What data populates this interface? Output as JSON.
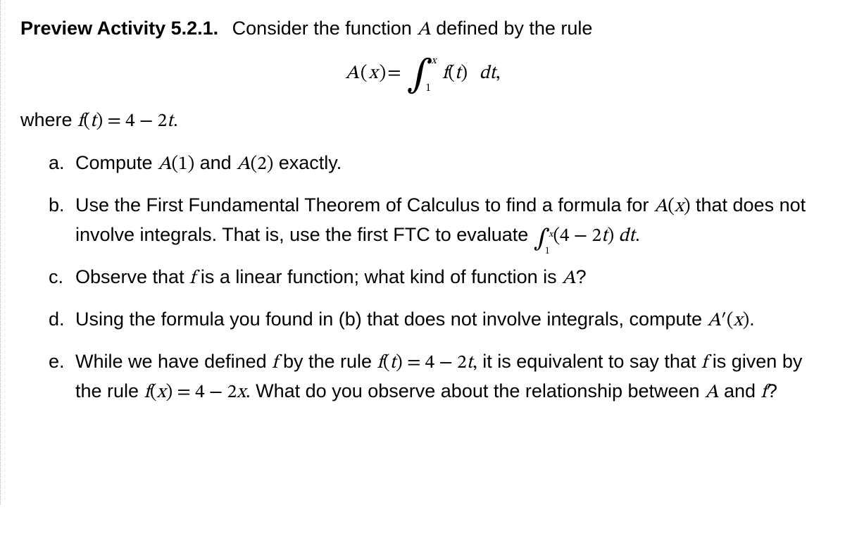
{
  "heading": {
    "label": "Preview Activity 5.2.1.",
    "intro_before": "Consider the function ",
    "intro_A": "A",
    "intro_after": " defined by the rule"
  },
  "display_equation": {
    "lhs_fn": "A",
    "lhs_arg": "x",
    "eq": " = ",
    "int_lower": "1",
    "int_upper": "x",
    "integrand_fn": "f",
    "integrand_arg": "t",
    "dt_d": "d",
    "dt_var": "t",
    "comma": ","
  },
  "where": {
    "prefix": "where ",
    "fn": "f",
    "arg": "t",
    "eq_rhs": " = 4 − 2",
    "rhs_var": "t",
    "period": "."
  },
  "items": {
    "a": {
      "marker": "a.",
      "t1": "Compute ",
      "m1_fn": "A",
      "m1_arg": "(1)",
      "t2": " and ",
      "m2_fn": "A",
      "m2_arg": "(2)",
      "t3": " exactly."
    },
    "b": {
      "marker": "b.",
      "t1": "Use the First Fundamental Theorem of Calculus to find a formula for ",
      "m1_fn": "A",
      "m1_arg": "x",
      "t2": " that does not involve integrals. That is, use the first FTC to evaluate ",
      "int_lower": "1",
      "int_upper": "x",
      "integrand_pre": "(4 − 2",
      "integrand_var": "t",
      "integrand_post": ") ",
      "dt_d": "d",
      "dt_var": "t",
      "t3": "."
    },
    "c": {
      "marker": "c.",
      "t1": "Observe that ",
      "m1": "f",
      "t2": " is a linear function; what kind of function is ",
      "m2": "A",
      "t3": "?"
    },
    "d": {
      "marker": "d.",
      "t1": "Using the formula you found in (b) that does not involve integrals, compute ",
      "m1_fn": "A",
      "m1_prime": "′",
      "m1_arg": "x",
      "t2": "."
    },
    "e": {
      "marker": "e.",
      "t1": "While we have defined ",
      "m1": "f",
      "t2": " by the rule ",
      "m2_fn": "f",
      "m2_arg": "t",
      "m2_rhs_pre": " = 4 − 2",
      "m2_rhs_var": "t",
      "m2_comma": ",",
      "t3": " it is equivalent to say that ",
      "m3": "f",
      "t4": " is given by the rule ",
      "m4_fn": "f",
      "m4_arg": "x",
      "m4_rhs_pre": " = 4 − 2",
      "m4_rhs_var": "x",
      "m4_period": ".",
      "t5": " What do you observe about the relationship between ",
      "m5": "A",
      "t6": " and ",
      "m6": "f",
      "t7": "?"
    }
  }
}
